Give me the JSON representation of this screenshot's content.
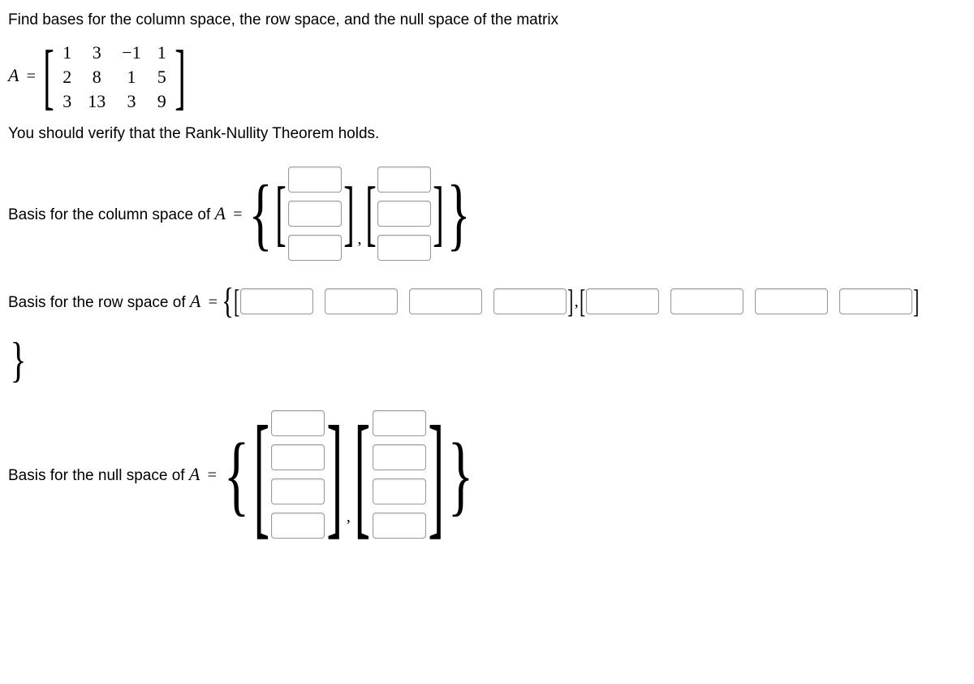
{
  "problem": {
    "intro": "Find bases for the column space, the row space, and the null space of the matrix",
    "verify": "You should verify that the Rank-Nullity Theorem holds.",
    "A_label": "A",
    "equals": "=",
    "matrix": [
      [
        "1",
        "3",
        "−1",
        "1"
      ],
      [
        "2",
        "8",
        "1",
        "5"
      ],
      [
        "3",
        "13",
        "3",
        "9"
      ]
    ]
  },
  "labels": {
    "colspace": "Basis for the column space of ",
    "rowspace": "Basis for the row space of ",
    "nullspace": "Basis for the null space of "
  },
  "symbols": {
    "lbrace": "{",
    "rbrace": "}",
    "lbrkt": "[",
    "rbrkt": "]",
    "comma": ","
  },
  "chart_data": {
    "type": "table",
    "title": "Matrix A",
    "rows": 3,
    "cols": 4,
    "values": [
      [
        1,
        3,
        -1,
        1
      ],
      [
        2,
        8,
        1,
        5
      ],
      [
        3,
        13,
        3,
        9
      ]
    ]
  }
}
